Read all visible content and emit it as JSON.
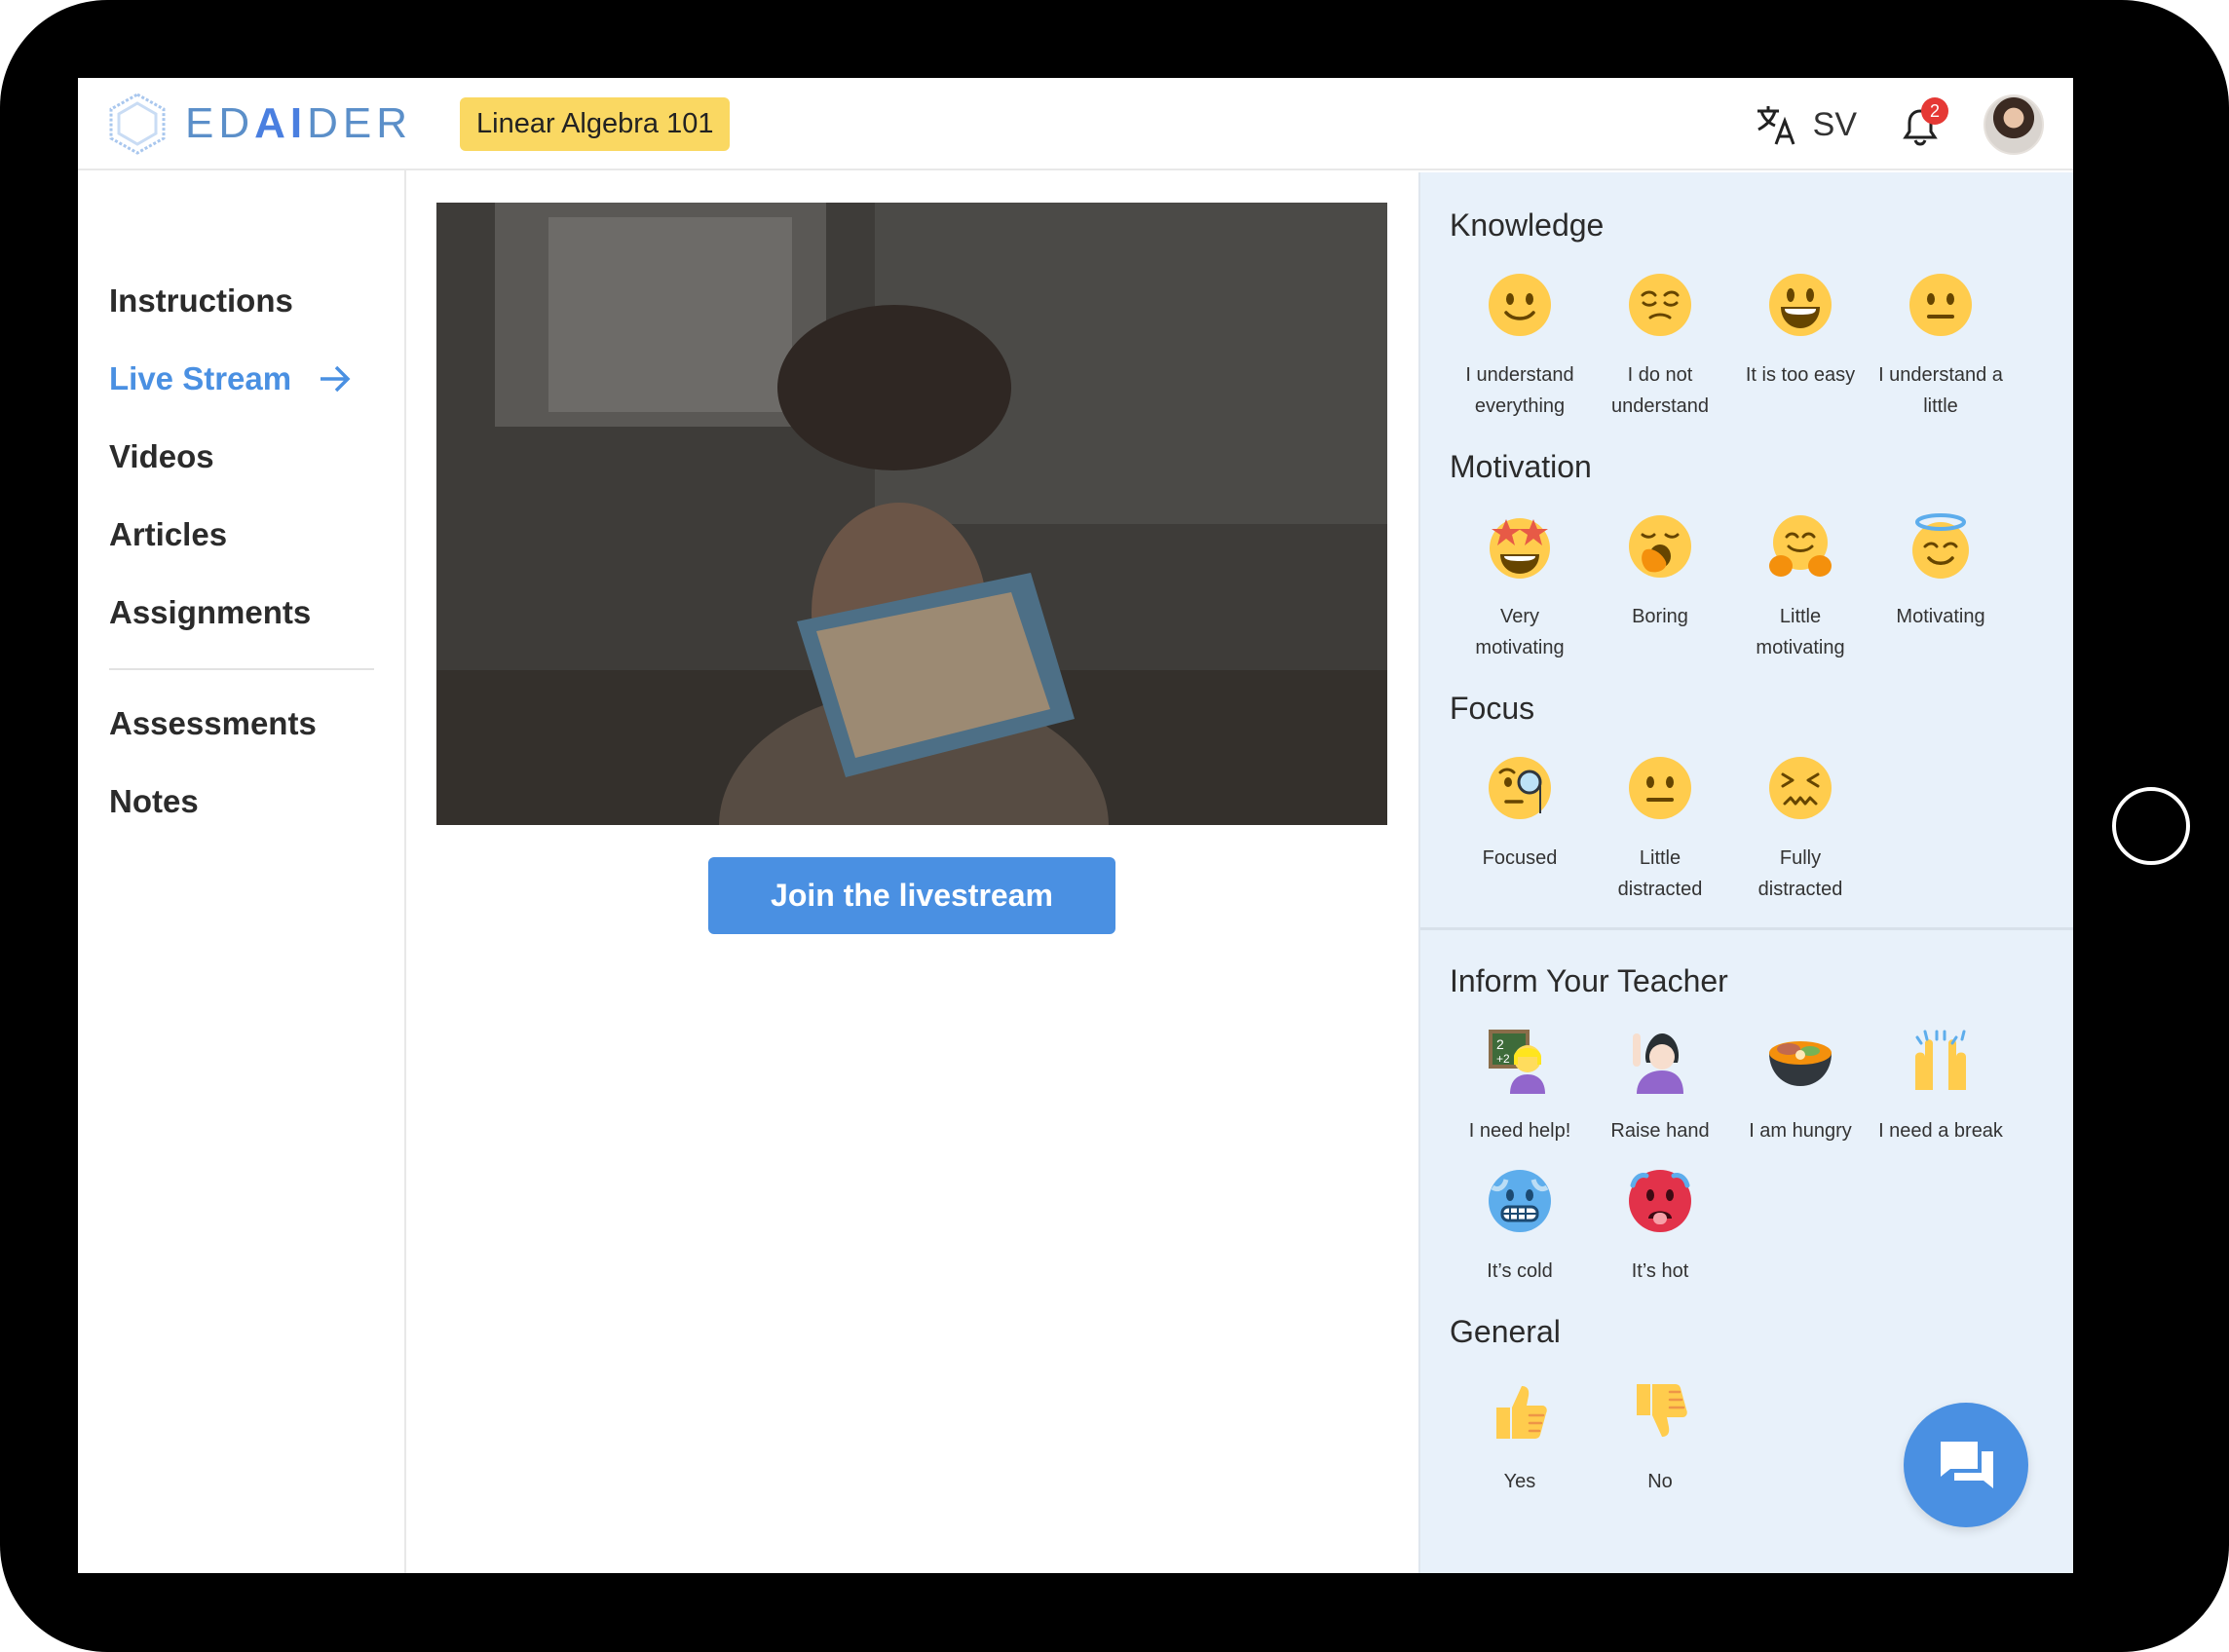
{
  "header": {
    "logo_text_a": "ED",
    "logo_text_b": "AI",
    "logo_text_c": "DER",
    "course": "Linear Algebra 101",
    "language": "SV",
    "notifications": "2",
    "icons": {
      "language": "translate-icon",
      "bell": "bell-icon",
      "avatar": "user-avatar"
    }
  },
  "sidebar": {
    "items": [
      {
        "label": "Instructions",
        "active": false
      },
      {
        "label": "Live Stream",
        "active": true
      },
      {
        "label": "Videos",
        "active": false
      },
      {
        "label": "Articles",
        "active": false
      },
      {
        "label": "Assignments",
        "active": false
      },
      {
        "label": "Assessments",
        "active": false
      },
      {
        "label": "Notes",
        "active": false
      }
    ]
  },
  "main": {
    "video_description_icon": "livestream-video",
    "join_label": "Join the livestream"
  },
  "panel": {
    "knowledge": {
      "title": "Knowledge",
      "items": [
        {
          "l1": "I understand",
          "l2": "everything",
          "icon": "slightly-smiling-face"
        },
        {
          "l1": "I do not",
          "l2": "understand",
          "icon": "relieved-face"
        },
        {
          "l1": "It is too easy",
          "l2": "",
          "icon": "grinning-face"
        },
        {
          "l1": "I understand a",
          "l2": "little",
          "icon": "neutral-face"
        }
      ]
    },
    "motivation": {
      "title": "Motivation",
      "items": [
        {
          "l1": "Very",
          "l2": "motivating",
          "icon": "star-struck"
        },
        {
          "l1": "Boring",
          "l2": "",
          "icon": "yawning-face"
        },
        {
          "l1": "Little",
          "l2": "motivating",
          "icon": "hugging-face"
        },
        {
          "l1": "Motivating",
          "l2": "",
          "icon": "halo-face"
        }
      ]
    },
    "focus": {
      "title": "Focus",
      "items": [
        {
          "l1": "Focused",
          "l2": "",
          "icon": "monocle-face"
        },
        {
          "l1": "Little",
          "l2": "distracted",
          "icon": "neutral-face"
        },
        {
          "l1": "Fully",
          "l2": "distracted",
          "icon": "confounded-face"
        }
      ]
    },
    "inform": {
      "title": "Inform Your Teacher",
      "items": [
        {
          "l1": "I need help!",
          "l2": "",
          "icon": "teacher-icon"
        },
        {
          "l1": "Raise hand",
          "l2": "",
          "icon": "raise-hand-icon"
        },
        {
          "l1": "I am hungry",
          "l2": "",
          "icon": "food-bowl-icon"
        },
        {
          "l1": "I need a break",
          "l2": "",
          "icon": "raised-hands-icon"
        },
        {
          "l1": "It’s cold",
          "l2": "",
          "icon": "cold-face"
        },
        {
          "l1": "It’s hot",
          "l2": "",
          "icon": "hot-face"
        }
      ]
    },
    "general": {
      "title": "General",
      "items": [
        {
          "l1": "Yes",
          "l2": "",
          "icon": "thumbs-up"
        },
        {
          "l1": "No",
          "l2": "",
          "icon": "thumbs-down"
        }
      ]
    },
    "chat_icon": "chat-icon"
  },
  "colors": {
    "accent": "#4a90e2",
    "badge": "#fad862",
    "panel_bg": "#e8f1fa",
    "notification": "#e53935"
  }
}
